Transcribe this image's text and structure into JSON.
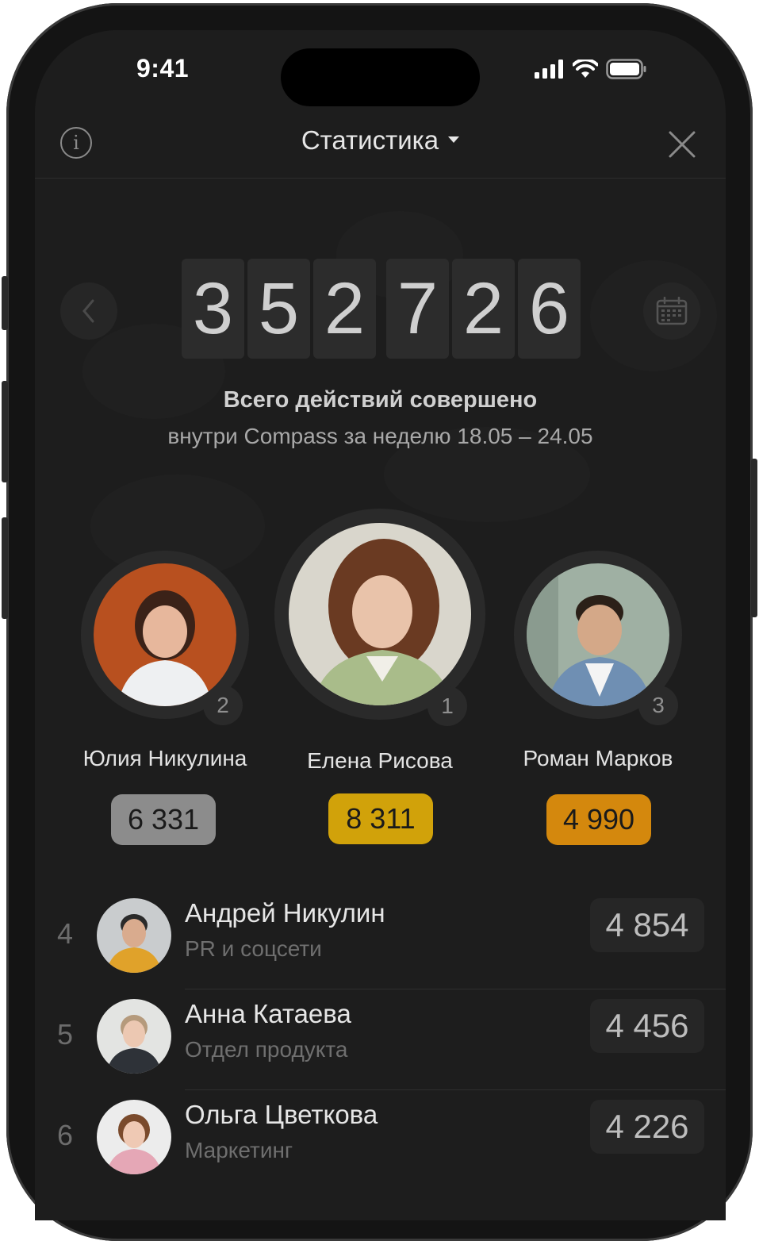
{
  "status_bar": {
    "time": "9:41"
  },
  "header": {
    "title": "Статистика"
  },
  "counter": {
    "digits": [
      "3",
      "5",
      "2",
      "7",
      "2",
      "6"
    ]
  },
  "caption": {
    "line1": "Всего действий совершено",
    "line2": "внутри Compass за неделю 18.05 – 24.05"
  },
  "podium": [
    {
      "rank": "2",
      "name": "Юлия Никулина",
      "score": "6 331",
      "color": "#8c8c8c"
    },
    {
      "rank": "1",
      "name": "Елена Рисова",
      "score": "8 311",
      "color": "#d1a20a"
    },
    {
      "rank": "3",
      "name": "Роман Марков",
      "score": "4 990",
      "color": "#d4880d"
    }
  ],
  "list": [
    {
      "rank": "4",
      "name": "Андрей Никулин",
      "dept": "PR и соцсети",
      "score": "4 854"
    },
    {
      "rank": "5",
      "name": "Анна Катаева",
      "dept": "Отдел продукта",
      "score": "4 456"
    },
    {
      "rank": "6",
      "name": "Ольга Цветкова",
      "dept": "Маркетинг",
      "score": "4 226"
    }
  ],
  "icons": {
    "info": "info-icon",
    "dropdown": "chevron-down-icon",
    "close": "close-icon",
    "prev": "chevron-left-icon",
    "calendar": "calendar-icon"
  }
}
